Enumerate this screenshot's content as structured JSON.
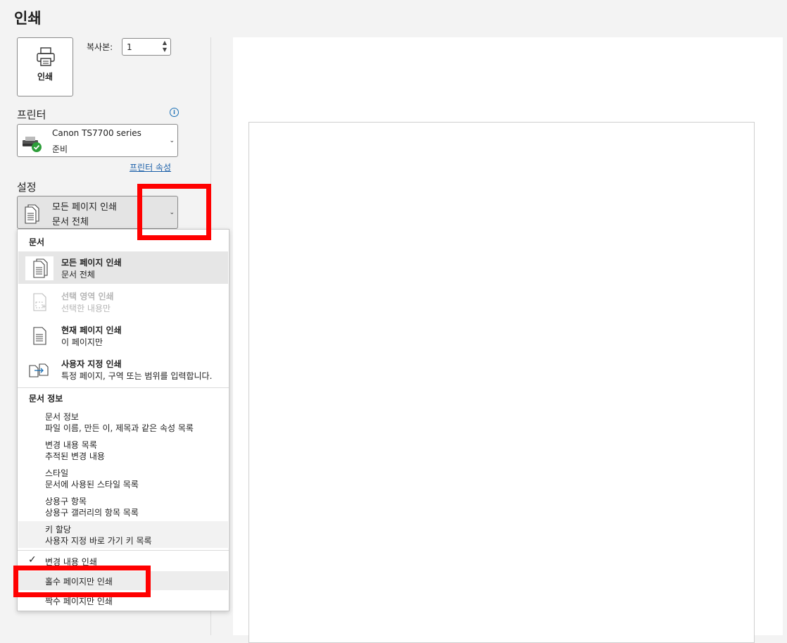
{
  "title": "인쇄",
  "print_button": {
    "label": "인쇄",
    "icon": "printer-icon"
  },
  "copies": {
    "label": "복사본:",
    "value": "1"
  },
  "printer": {
    "header": "프린터",
    "name": "Canon TS7700 series",
    "status": "준비",
    "properties_link": "프린터 속성"
  },
  "settings": {
    "header": "설정",
    "selected_title": "모든 페이지 인쇄",
    "selected_sub": "문서 전체"
  },
  "dropdown": {
    "doc_header": "문서",
    "options": [
      {
        "title": "모든 페이지 인쇄",
        "sub": "문서 전체",
        "icon": "all-pages-icon",
        "selected": true
      },
      {
        "title": "선택 영역 인쇄",
        "sub": "선택한 내용만",
        "icon": "selection-icon",
        "disabled": true
      },
      {
        "title": "현재 페이지 인쇄",
        "sub": "이 페이지만",
        "icon": "current-page-icon"
      },
      {
        "title": "사용자 지정 인쇄",
        "sub": "특정 페이지, 구역 또는 범위를 입력합니다.",
        "icon": "custom-print-icon"
      }
    ],
    "info_header": "문서 정보",
    "info_items": [
      {
        "title": "문서 정보",
        "sub": "파일 이름, 만든 이, 제목과 같은 속성 목록"
      },
      {
        "title": "변경 내용 목록",
        "sub": "추적된 변경 내용"
      },
      {
        "title": "스타일",
        "sub": "문서에 사용된 스타일 목록"
      },
      {
        "title": "상용구 항목",
        "sub": "상용구 갤러리의 항목 목록"
      },
      {
        "title": "키 할당",
        "sub": "사용자 지정 바로 가기 키 목록"
      }
    ],
    "print_markup": {
      "label": "변경 내용 인쇄",
      "checked": true
    },
    "odd_pages": "홀수 페이지만 인쇄",
    "even_pages": "짝수 페이지만 인쇄"
  },
  "colors": {
    "highlight": "#ff0000",
    "link": "#1a5fa8",
    "ready_green": "#2e9e3a"
  }
}
